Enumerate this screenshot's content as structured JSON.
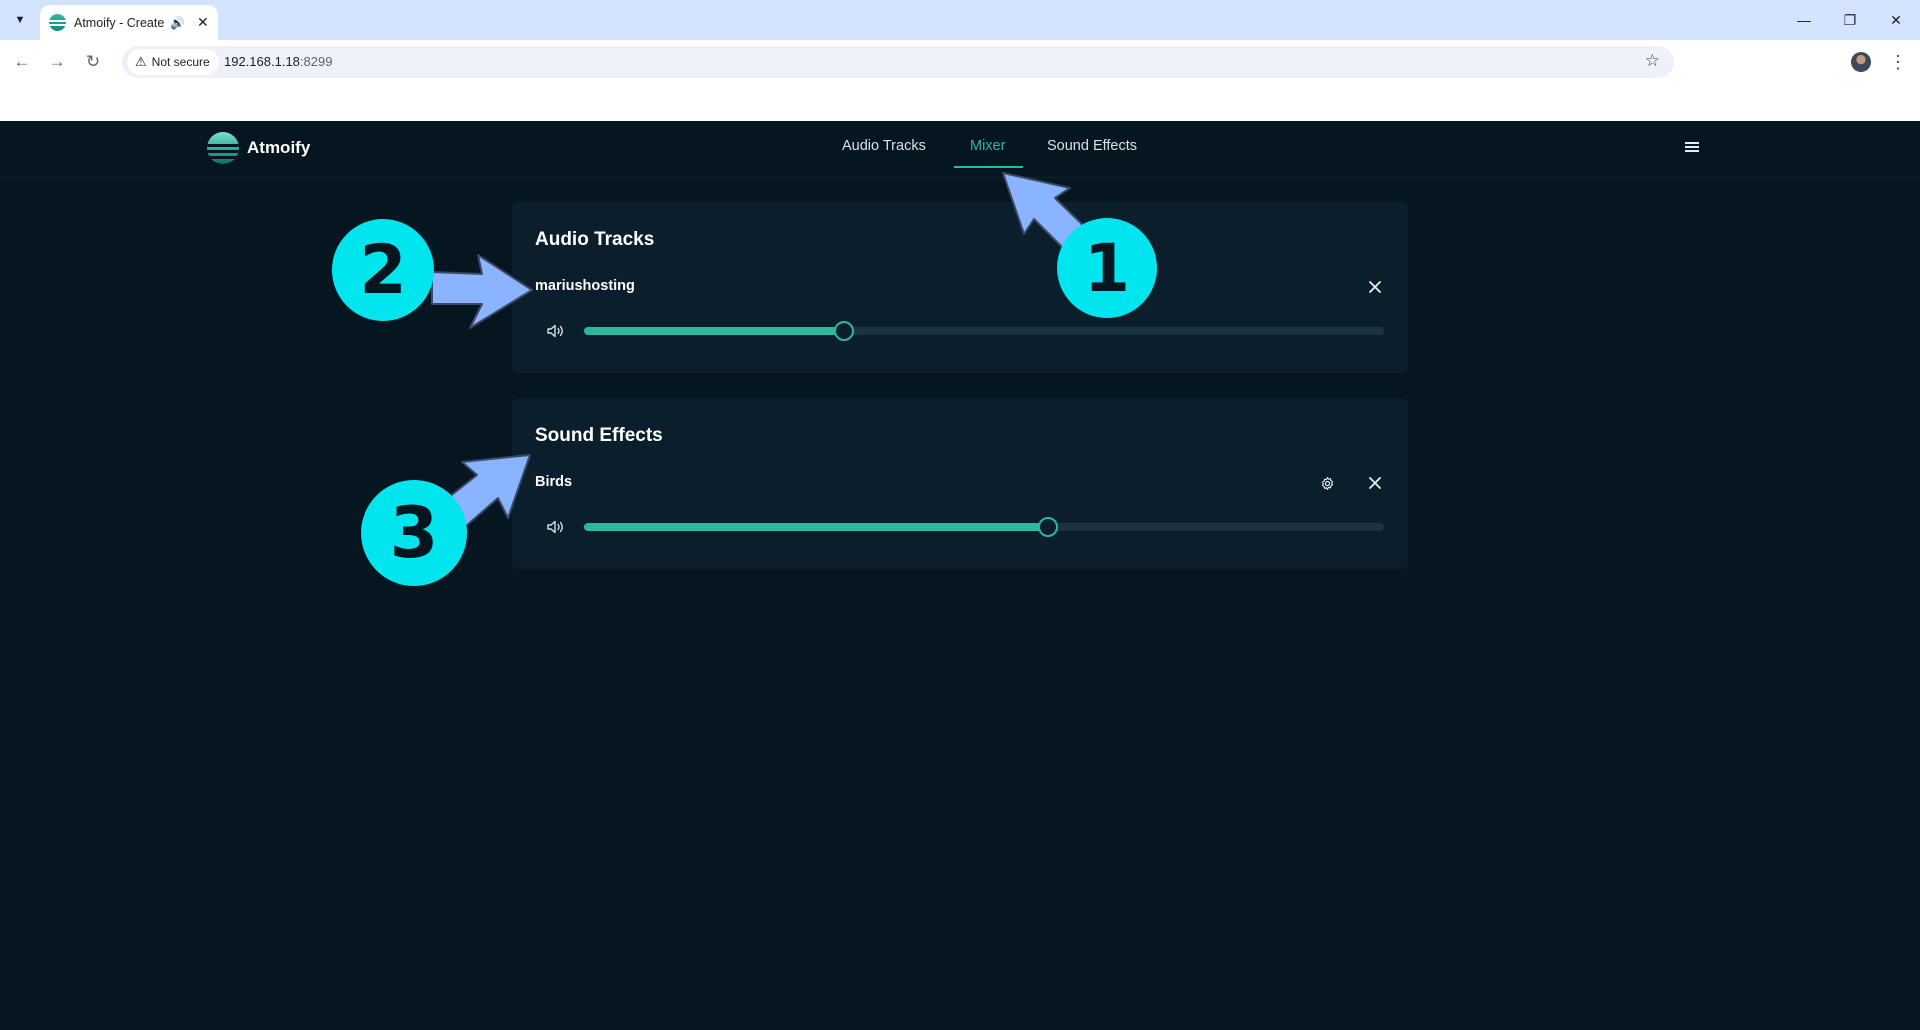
{
  "browser": {
    "tab_title": "Atmoify - Create",
    "security_label": "Not secure",
    "url_host": "192.168.1.18",
    "url_port": ":8299"
  },
  "app": {
    "brand": "Atmoify",
    "nav": {
      "audio_tracks": "Audio Tracks",
      "mixer": "Mixer",
      "sound_effects": "Sound Effects",
      "active": "Mixer"
    },
    "accent_color": "#2bb89c",
    "background_color": "#051621",
    "card_color": "#0b1e2b"
  },
  "mixer": {
    "audio_tracks": {
      "title": "Audio Tracks",
      "items": [
        {
          "name": "mariushosting",
          "volume": 0.325,
          "has_settings": false
        }
      ]
    },
    "sound_effects": {
      "title": "Sound Effects",
      "items": [
        {
          "name": "Birds",
          "volume": 0.58,
          "has_settings": true
        }
      ]
    }
  },
  "annotations": {
    "badge_color": "#00e5ee",
    "arrow_color": "#8ab4ff",
    "labels": [
      "1",
      "2",
      "3"
    ]
  }
}
